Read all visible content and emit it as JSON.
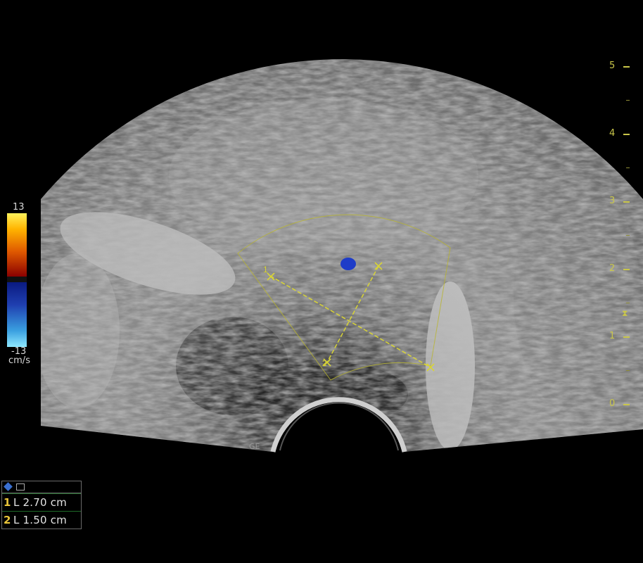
{
  "color_scale": {
    "top_value": "13",
    "bottom_value": "-13",
    "unit": "cm/s",
    "colors": {
      "positive_top": "#fff15a",
      "positive_bottom": "#8a0000",
      "negative_top": "#0a1a80",
      "negative_bottom": "#8ee8ff"
    }
  },
  "depth_scale": {
    "labels": [
      "5",
      "4",
      "3",
      "2",
      "1",
      "0"
    ],
    "color": "#c9c64a"
  },
  "probe_label": "GE",
  "measurement_panel": {
    "icon": "diamond-icon",
    "rows": [
      {
        "index": "1",
        "text": "L 2.70 cm"
      },
      {
        "index": "2",
        "text": "L 1.50 cm"
      }
    ]
  },
  "calipers": {
    "color": "#d8d436",
    "markers": [
      "1",
      "2"
    ]
  },
  "doppler_flow_color": "#1e3cc8"
}
